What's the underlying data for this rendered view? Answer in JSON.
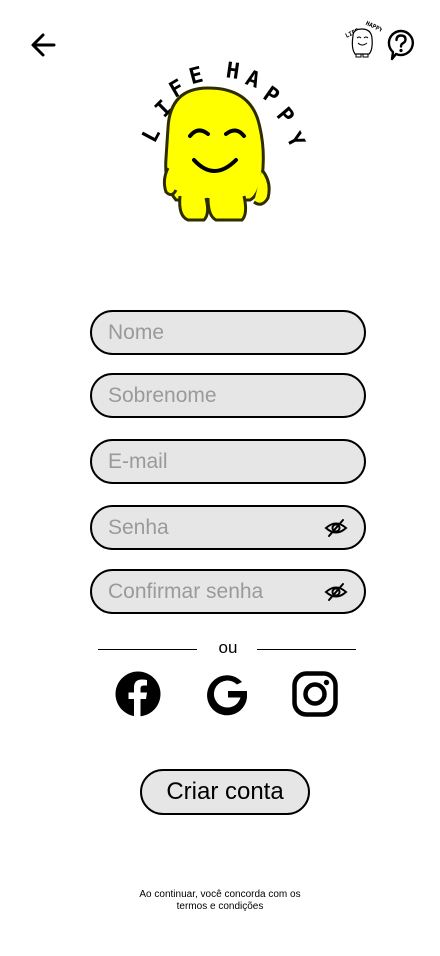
{
  "header": {
    "back_icon": "arrow-left-icon",
    "mini_logo_icon": "life-happy-mini-logo",
    "help_icon": "question-circle-icon"
  },
  "logo": {
    "text": "LIFE HAPPY",
    "color": "#ffff00"
  },
  "form": {
    "nome_placeholder": "Nome",
    "sobrenome_placeholder": "Sobrenome",
    "email_placeholder": "E-mail",
    "senha_placeholder": "Senha",
    "confirmar_placeholder": "Confirmar senha"
  },
  "divider_text": "ou",
  "social": {
    "facebook_icon": "facebook-icon",
    "google_icon": "google-icon",
    "instagram_icon": "instagram-icon"
  },
  "create_button_label": "Criar conta",
  "terms": {
    "line1": "Ao continuar, você concorda com os",
    "line2": "termos e condições"
  }
}
